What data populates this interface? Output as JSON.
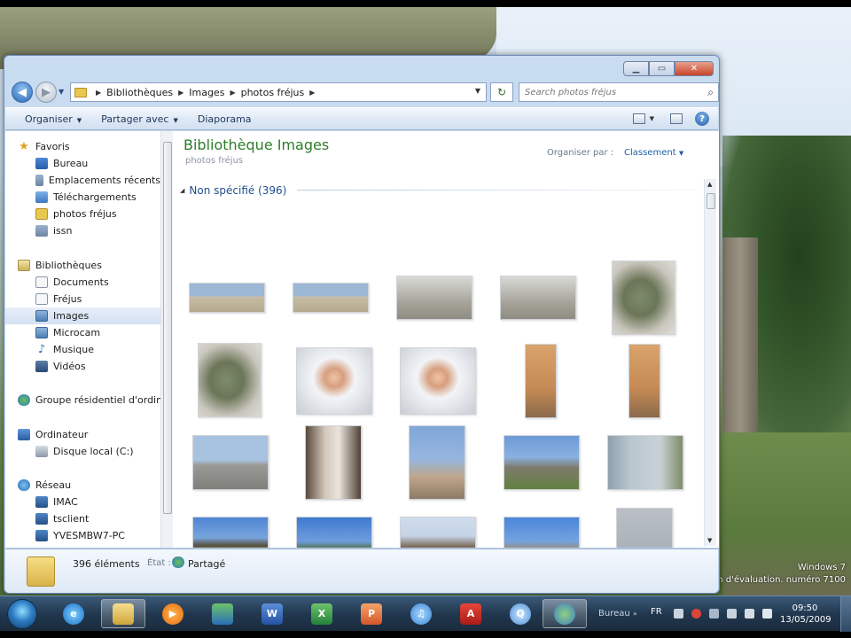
{
  "window": {
    "caption_buttons": {
      "minimize": "▁",
      "maximize": "▭",
      "close": "✕"
    }
  },
  "address": {
    "crumbs": [
      "Bibliothèques",
      "Images",
      "photos fréjus"
    ],
    "search_placeholder": "Search photos fréjus"
  },
  "commands": [
    {
      "label": "Organiser",
      "has_arrow": true
    },
    {
      "label": "Partager avec",
      "has_arrow": true
    },
    {
      "label": "Diaporama",
      "has_arrow": false
    }
  ],
  "nav": {
    "favorites": {
      "label": "Favoris",
      "items": [
        "Bureau",
        "Emplacements récents",
        "Téléchargements",
        "photos fréjus",
        "issn"
      ]
    },
    "libraries": {
      "label": "Bibliothèques",
      "items": [
        "Documents",
        "Fréjus",
        "Images",
        "Microcam",
        "Musique",
        "Vidéos"
      ],
      "selected": "Images"
    },
    "homegroup": "Groupe résidentiel d'ordin",
    "computer": {
      "label": "Ordinateur",
      "items": [
        "Disque local (C:)"
      ]
    },
    "network": {
      "label": "Réseau",
      "items": [
        "IMAC",
        "tsclient",
        "YVESMBW7-PC"
      ]
    }
  },
  "content": {
    "title": "Bibliothèque Images",
    "subtitle": "photos fréjus",
    "arrange_label": "Organiser par :",
    "arrange_value": "Classement",
    "group_label": "Non spécifié (396)"
  },
  "details": {
    "count": "396 éléments",
    "state_label": "État :",
    "state": "Partagé"
  },
  "taskbar": {
    "desktop_label": "Bureau",
    "language": "FR",
    "time": "09:50",
    "date": "13/05/2009"
  },
  "watermark": {
    "line1": "Windows 7",
    "line2": "n d'évaluation. numéro 7100"
  },
  "colors": {
    "title_green": "#2d7d2a",
    "link_blue": "#1f5fa8",
    "group_blue": "#1e4f8f"
  }
}
